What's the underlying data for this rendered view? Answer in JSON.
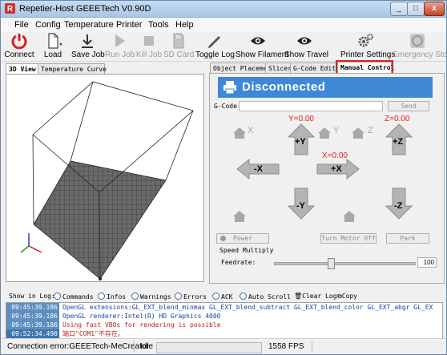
{
  "window": {
    "title": "Repetier-Host GEEETech V0.90D"
  },
  "menu": [
    "File",
    "Config",
    "Temperature",
    "Printer",
    "Tools",
    "Help"
  ],
  "toolbar": {
    "connect": "Connect",
    "load": "Load",
    "save_job": "Save Job",
    "run_job": "Run Job",
    "kill_job": "Kill Job",
    "sd_card": "SD Card",
    "toggle_log": "Toggle Log",
    "show_filament": "Show Filament",
    "show_travel": "Show Travel",
    "printer_settings": "Printer Settings",
    "emergency_stop": "Emergency Stop"
  },
  "left_tabs": [
    "3D View",
    "Temperature Curve"
  ],
  "right_tabs": [
    "Object Placement",
    "Slicer",
    "G-Code Editor",
    "Manual Control"
  ],
  "manual": {
    "status": "Disconnected",
    "gcode_label": "G-Code:",
    "send": "Send",
    "x_label": "X",
    "y_label": "Y",
    "z_label": "Z",
    "y_pos": "Y=0.00",
    "x_pos": "X=0.00",
    "z_pos": "Z=0.00",
    "plus_y": "+Y",
    "minus_y": "-Y",
    "plus_x": "+X",
    "minus_x": "-X",
    "plus_z": "+Z",
    "minus_z": "-Z",
    "power": "Power",
    "turn_motor_off": "Turn Motor Off",
    "park": "Park",
    "speed_multiply": "Speed Multiply",
    "feedrate": "Feedrate:",
    "feedrate_value": "100",
    "feedrate_fraction": 0.4,
    "colors": {
      "status_bg": "#3f88d6",
      "position_text": "#e02020"
    }
  },
  "logbar": {
    "show_in_log": "Show in Log:",
    "commands": "Commands",
    "infos": "Infos",
    "warnings": "Warnings",
    "errors": "Errors",
    "ack": "ACK",
    "auto_scroll": "Auto Scroll",
    "clear_log": "Clear Log",
    "copy": "Copy"
  },
  "log": [
    {
      "time": "09:45:39.186",
      "msg": "OpenGL extensions:GL_EXT_blend_minmax GL_EXT_blend_subtract GL_EXT_blend_color GL_EXT_abgr GL_EX",
      "color": "#1a3fa8"
    },
    {
      "time": "09:45:39.186",
      "msg": "OpenGL renderer:Intel(R) HD Graphics 4000",
      "color": "#1a3fa8"
    },
    {
      "time": "09:45:39.186",
      "msg": "Using fast VBOs for rendering is possible",
      "color": "#c02020"
    },
    {
      "time": "09:52:34.498",
      "msg": "端口\"COM1\"不存在。",
      "color": "#c02020"
    }
  ],
  "status": {
    "connection": "Connection error:GEEETech-MeCreator",
    "state": "Idle",
    "fps": "1558 FPS"
  }
}
